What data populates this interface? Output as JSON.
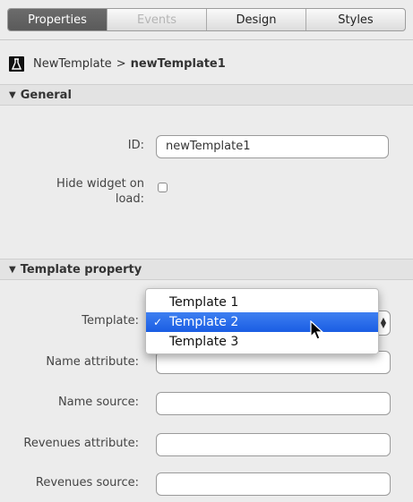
{
  "tabs": [
    {
      "label": "Properties",
      "state": "active"
    },
    {
      "label": "Events",
      "state": "disabled"
    },
    {
      "label": "Design",
      "state": "normal"
    },
    {
      "label": "Styles",
      "state": "normal"
    }
  ],
  "breadcrumb": {
    "icon": "flask-icon",
    "parent": "NewTemplate",
    "separator": ">",
    "current": "newTemplate1"
  },
  "general": {
    "header": "General",
    "id_label": "ID:",
    "id_value": "newTemplate1",
    "hide_label_1": "Hide widget on",
    "hide_label_2": "load:",
    "hide_checked": false
  },
  "template_property": {
    "header": "Template property",
    "template_label": "Template:",
    "template_options": [
      "Template 1",
      "Template 2",
      "Template 3"
    ],
    "template_selected": "Template 2",
    "name_attribute_label": "Name attribute:",
    "name_attribute_value": "",
    "name_source_label": "Name source:",
    "name_source_value": "",
    "revenues_attribute_label": "Revenues attribute:",
    "revenues_attribute_value": "",
    "revenues_source_label": "Revenues source:",
    "revenues_source_value": ""
  },
  "colors": {
    "active_tab": "#5f5f5f",
    "selection": "#2a6df0",
    "panel_bg": "#ececec"
  }
}
